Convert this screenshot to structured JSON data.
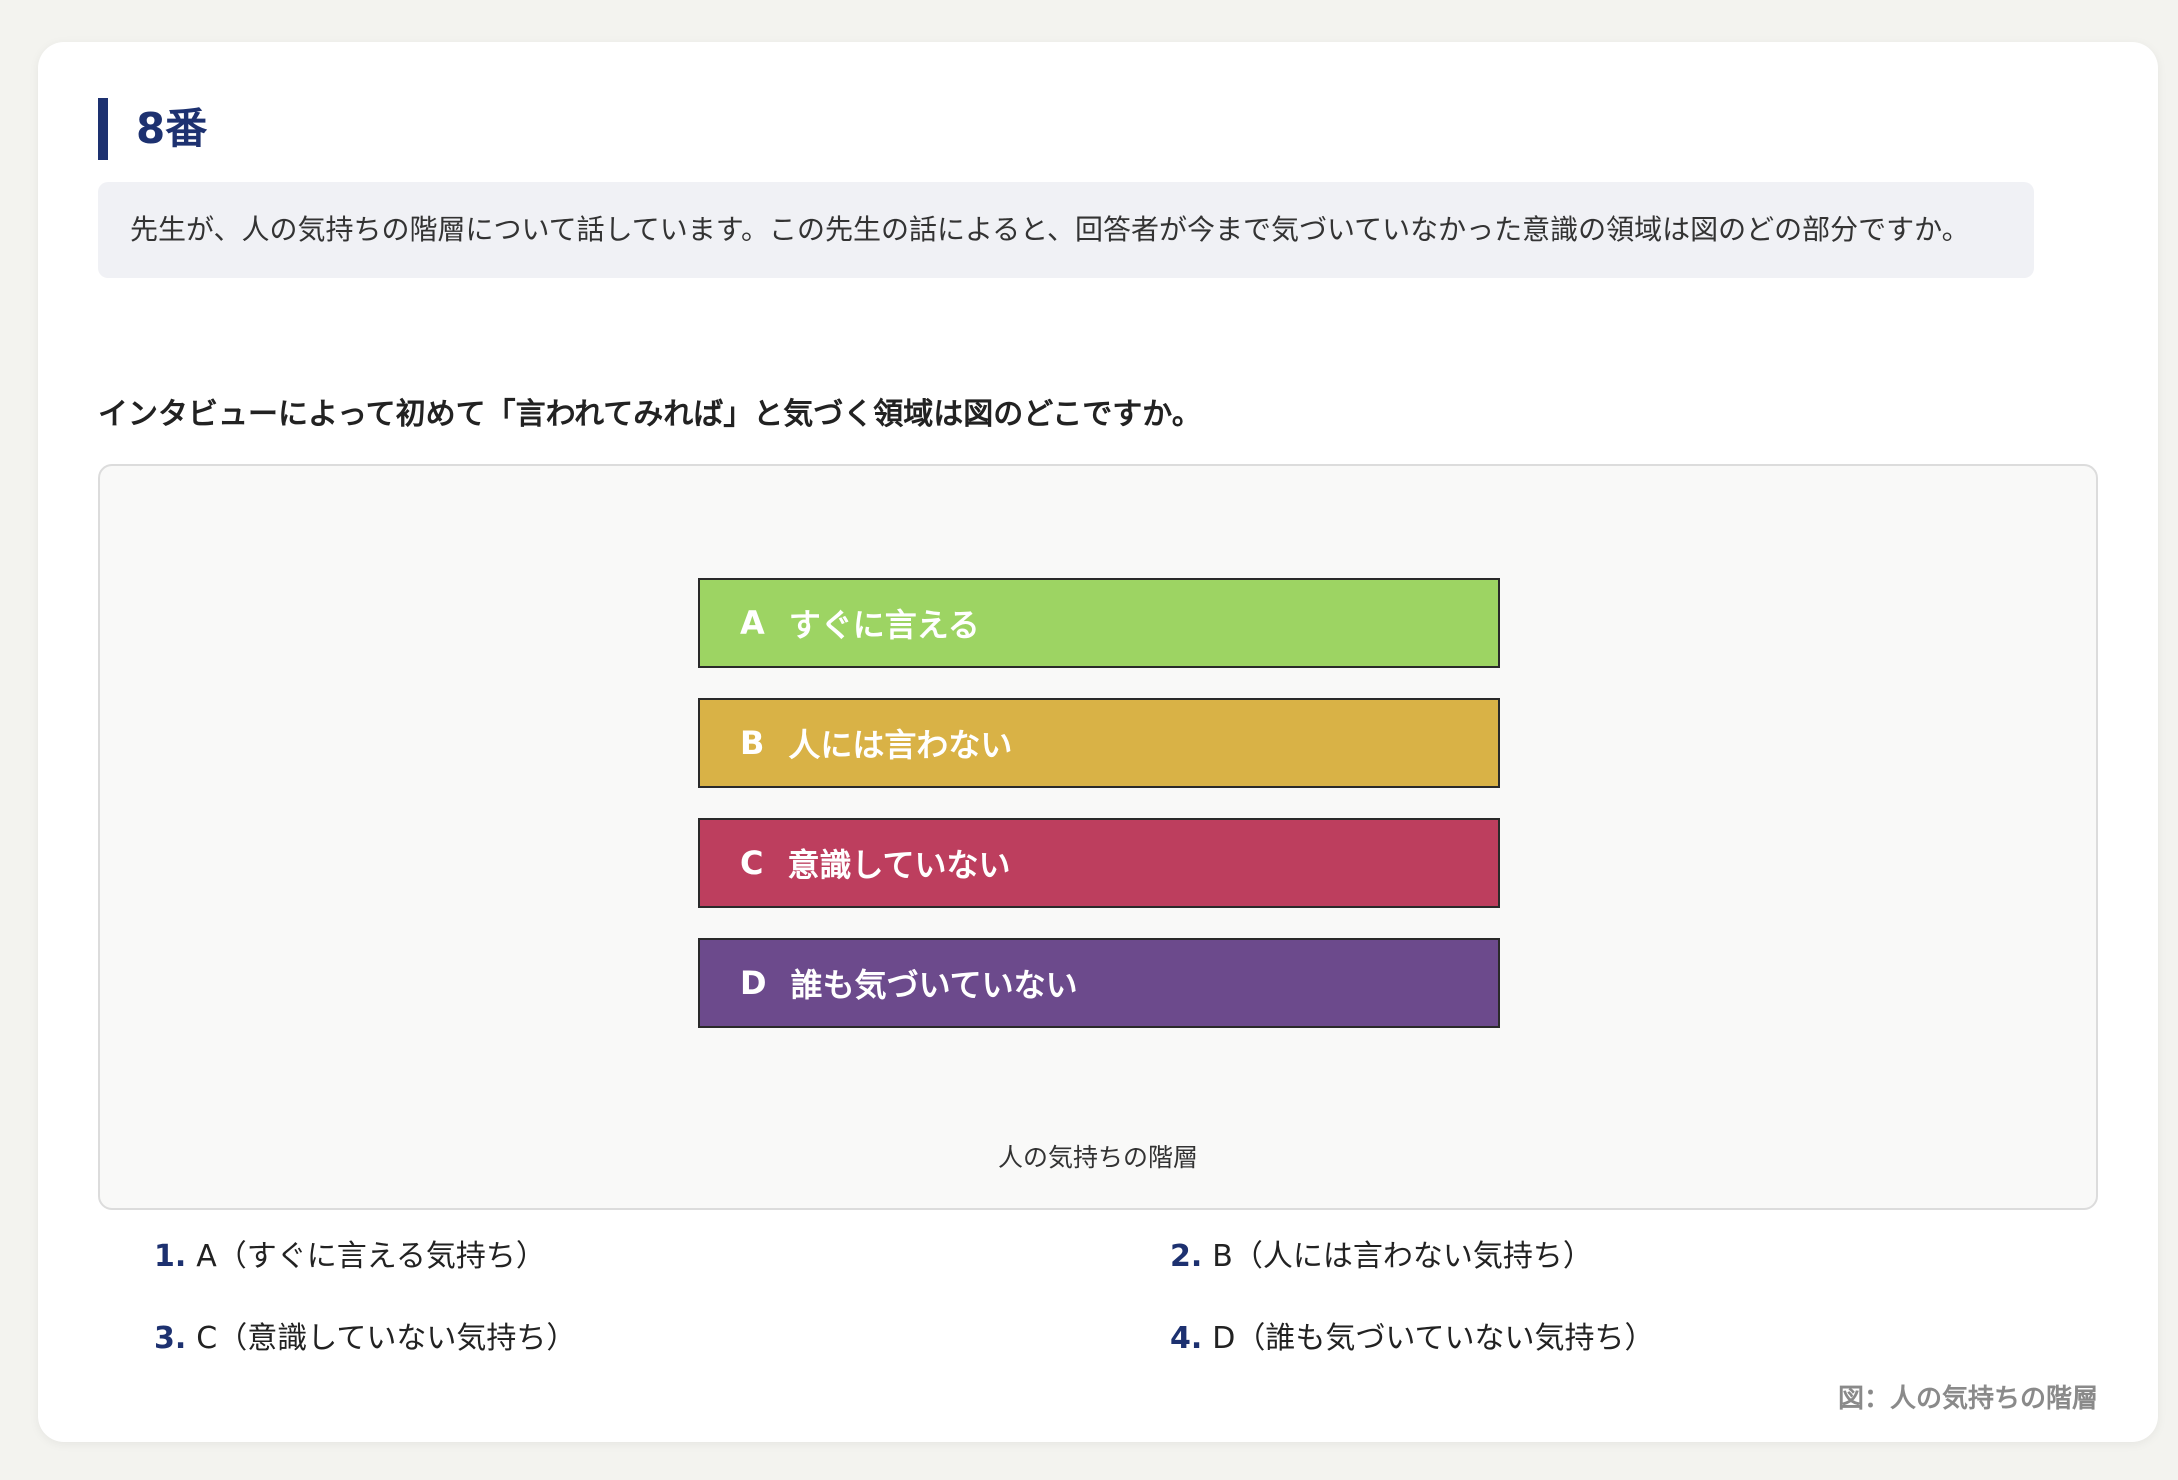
{
  "header": {
    "title": "8番"
  },
  "prompt": "先生が、人の気持ちの階層について話しています。この先生の話によると、回答者が今まで気づいていなかった意識の領域は図のどの部分ですか。",
  "question": "インタビューによって初めて「言われてみれば」と気づく領域は図のどこですか。",
  "figure": {
    "layers": [
      {
        "letter": "A",
        "label": "すぐに言える",
        "color": "#9dd463"
      },
      {
        "letter": "B",
        "label": "人には言わない",
        "color": "#d9b246"
      },
      {
        "letter": "C",
        "label": "意識していない",
        "color": "#bd3e5e"
      },
      {
        "letter": "D",
        "label": "誰も気づいていない",
        "color": "#6c4a8c"
      }
    ],
    "caption": "人の気持ちの階層"
  },
  "options": [
    {
      "num": "1.",
      "text": "A（すぐに言える気持ち）"
    },
    {
      "num": "2.",
      "text": "B（人には言わない気持ち）"
    },
    {
      "num": "3.",
      "text": "C（意識していない気持ち）"
    },
    {
      "num": "4.",
      "text": "D（誰も気づいていない気持ち）"
    }
  ],
  "footnote": "図：人の気持ちの階層",
  "colors": {
    "accent": "#1d3170"
  }
}
